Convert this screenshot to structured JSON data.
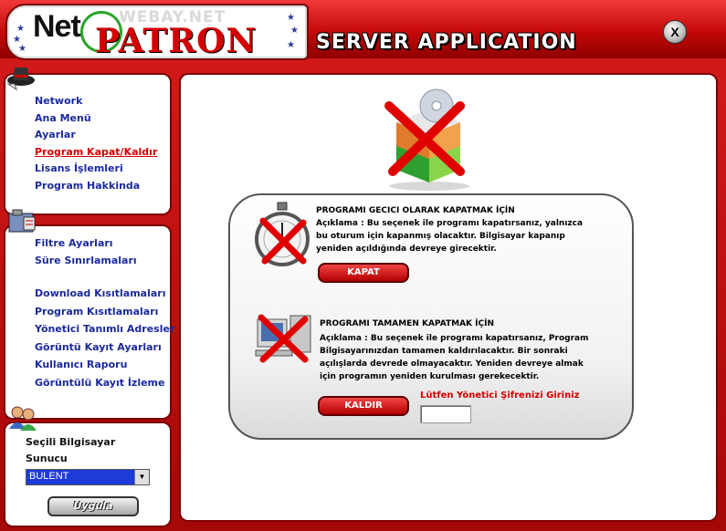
{
  "header": {
    "logo_net": "Net",
    "logo_webay": "WEBAY.NET",
    "logo_patron": "PATRON",
    "title": "SERVER APPLICATION",
    "close_label": "X"
  },
  "sidebar": {
    "group1": [
      {
        "label": "Network"
      },
      {
        "label": "Ana Menü"
      },
      {
        "label": "Ayarlar"
      },
      {
        "label": "Program Kapat/Kaldır"
      },
      {
        "label": "Lisans İşlemleri"
      },
      {
        "label": "Program Hakkinda"
      }
    ],
    "group2": [
      {
        "label": "Filtre Ayarları"
      },
      {
        "label": "Süre Sınırlamaları"
      },
      {
        "label": "Download Kısıtlamaları"
      },
      {
        "label": "Program Kısıtlamaları"
      },
      {
        "label": "Yönetici Tanımlı Adresler"
      },
      {
        "label": "Görüntü Kayıt Ayarları"
      },
      {
        "label": "Kullanıcı Raporu"
      },
      {
        "label": "Görüntülü Kayıt İzleme"
      }
    ],
    "computer": {
      "label_line1": "Seçili Bilgisayar",
      "label_line2": "Sunucu",
      "selected": "BULENT",
      "apply_label": "Uygula"
    }
  },
  "main": {
    "temp": {
      "title": "PROGRAMI GECICI OLARAK KAPATMAK İÇİN",
      "desc_line1": "Açıklama : Bu seçenek ile programı kapatırsanız, yalnızca",
      "desc_line2": "bu oturum için kapanmış olacaktır. Bilgisayar kapanıp",
      "desc_line3": "yeniden açıldığında devreye girecektir.",
      "button": "KAPAT"
    },
    "perm": {
      "title": "PROGRAMI TAMAMEN KAPATMAK İÇİN",
      "desc_line1": "Açıklama : Bu seçenek ile programı kapatırsanız, Program",
      "desc_line2": "Bilgisayarınızdan tamamen kaldırılacaktır. Bir sonraki",
      "desc_line3": "açılışlarda devrede olmayacaktır. Yeniden devreye almak",
      "desc_line4": "için programın yeniden kurulması gerekecektir.",
      "button": "KALDIR",
      "password_prompt": "Lütfen Yönetici Şifrenizi Giriniz",
      "password_value": ""
    }
  },
  "colors": {
    "frame_red": "#c40a0a",
    "nav_blue": "#1b2a9c",
    "nav_active": "#d40000",
    "select_bg": "#1d3bd6"
  },
  "icons": [
    "pc-setup-icon",
    "stopwatch-icon",
    "computer-remove-icon",
    "red-x-icon",
    "user-group-icon",
    "toolbox-icon",
    "hat-icon"
  ]
}
